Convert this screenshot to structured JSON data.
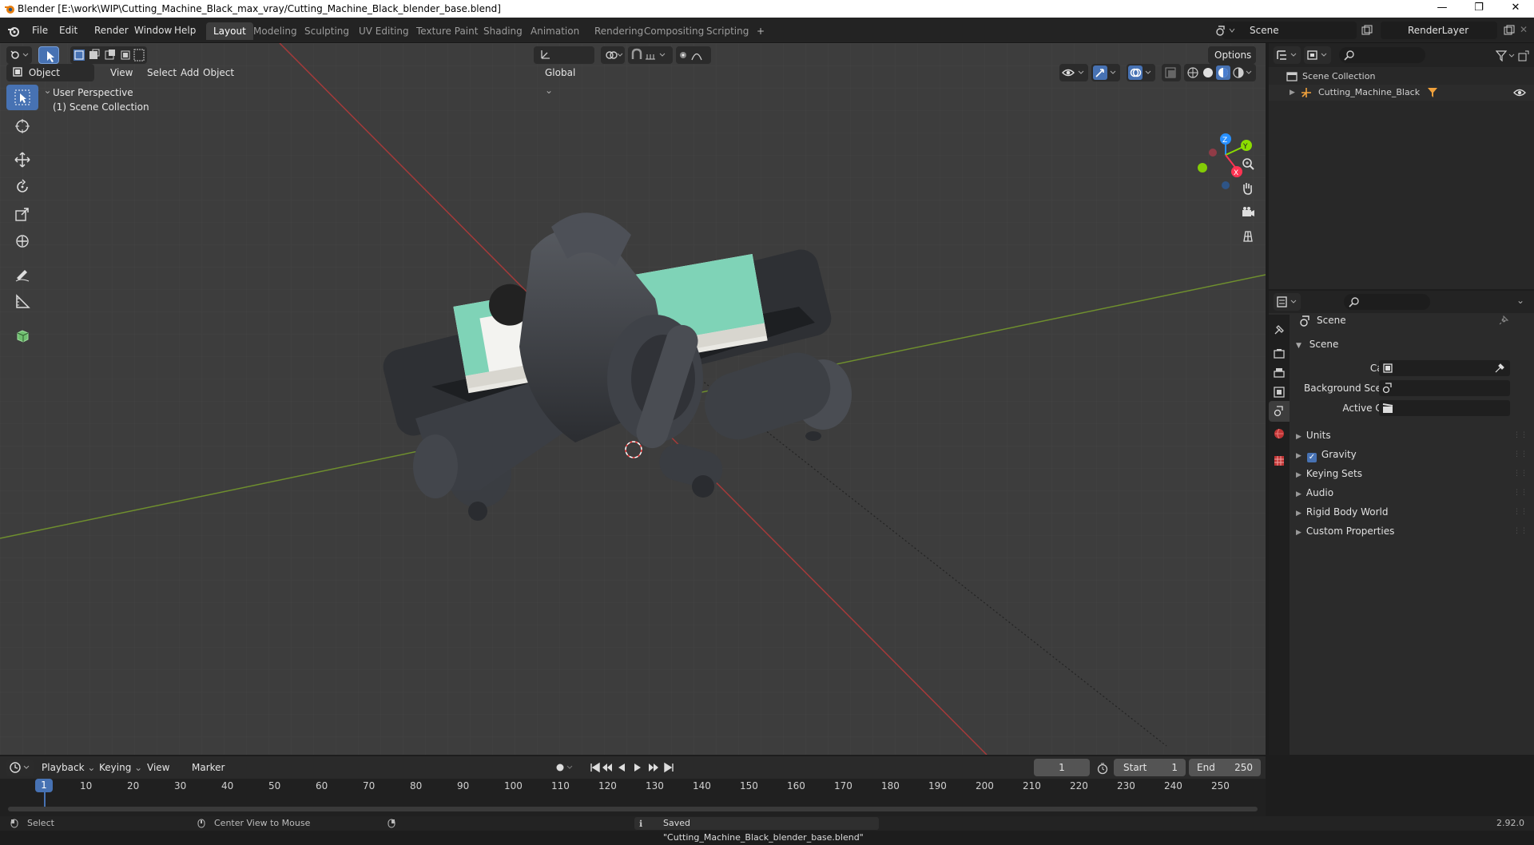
{
  "window": {
    "title": "Blender [E:\\work\\WIP\\Cutting_Machine_Black_max_vray/Cutting_Machine_Black_blender_base.blend]",
    "min": "—",
    "max": "❐",
    "close": "✕"
  },
  "menus": [
    "File",
    "Edit",
    "Render",
    "Window",
    "Help"
  ],
  "workspaces": [
    "Layout",
    "Modeling",
    "Sculpting",
    "UV Editing",
    "Texture Paint",
    "Shading",
    "Animation",
    "Rendering",
    "Compositing",
    "Scripting"
  ],
  "active_workspace": "Layout",
  "scene_name": "Scene",
  "view_layer": "RenderLayer",
  "viewport_header": {
    "mode": "Object Mode",
    "menus": [
      "View",
      "Select",
      "Add",
      "Object"
    ],
    "orientation": "Global",
    "options": "Options"
  },
  "viewport_overlay": {
    "line1": "User Perspective",
    "line2": "(1) Scene Collection"
  },
  "gizmo_axes": {
    "x": "X",
    "y": "Y",
    "z": "Z"
  },
  "outliner": {
    "root": "Scene Collection",
    "items": [
      {
        "label": "Cutting_Machine_Black"
      }
    ]
  },
  "properties": {
    "header": "Scene",
    "panel_title": "Scene",
    "fields": [
      {
        "label": "Camera"
      },
      {
        "label": "Background Scene"
      },
      {
        "label": "Active Clip"
      }
    ],
    "sections": [
      "Units",
      "Gravity",
      "Keying Sets",
      "Audio",
      "Rigid Body World",
      "Custom Properties"
    ],
    "gravity_checked": true
  },
  "timeline": {
    "menus": [
      "Playback",
      "Keying",
      "View",
      "Marker"
    ],
    "current_frame": "1",
    "start_label": "Start",
    "start": "1",
    "end_label": "End",
    "end": "250",
    "ruler": [
      "1",
      "10",
      "20",
      "30",
      "40",
      "50",
      "60",
      "70",
      "80",
      "90",
      "100",
      "110",
      "120",
      "130",
      "140",
      "150",
      "160",
      "170",
      "180",
      "190",
      "200",
      "210",
      "220",
      "230",
      "240",
      "250"
    ]
  },
  "statusbar": {
    "left": "Select",
    "middle": "Center View to Mouse",
    "message": "Saved \"Cutting_Machine_Black_blender_base.blend\"",
    "version": "2.92.0"
  },
  "colors": {
    "accent": "#4772b3",
    "x_axis": "#ff3352",
    "y_axis": "#8bdc00",
    "z_axis": "#2890ff"
  }
}
